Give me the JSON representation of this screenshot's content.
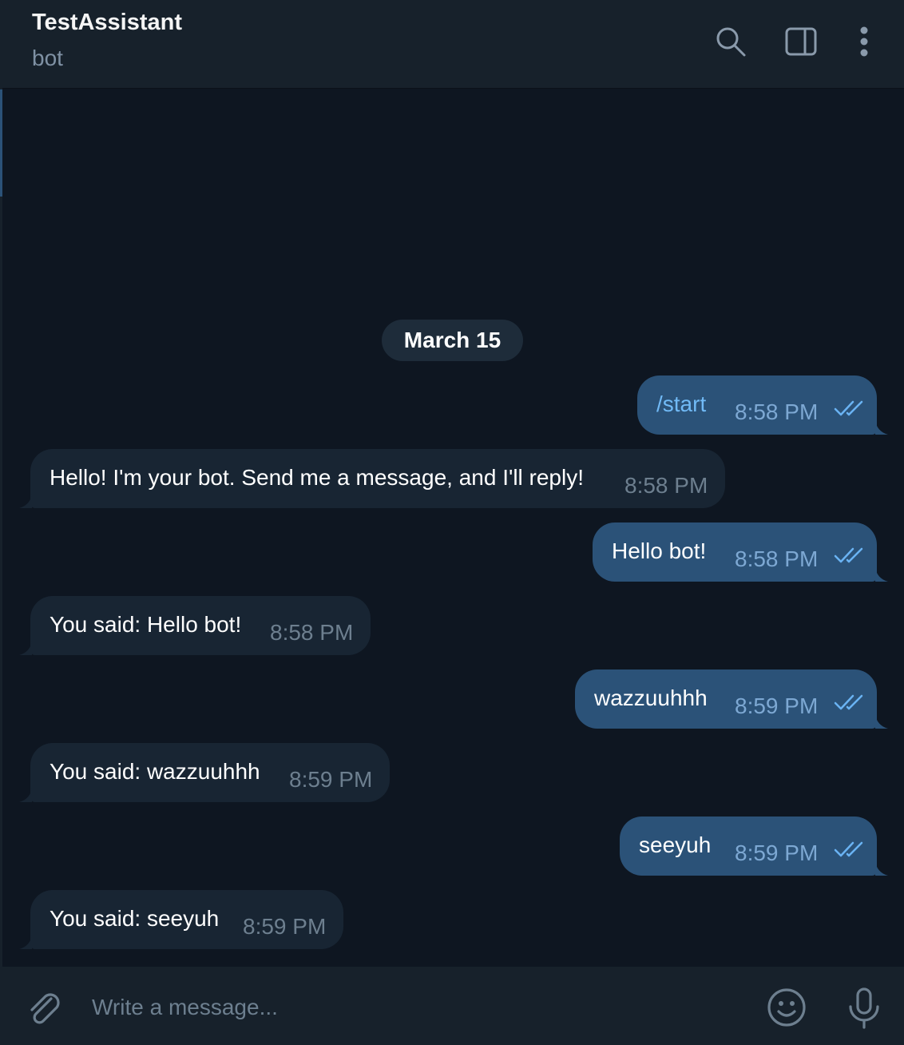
{
  "header": {
    "title": "TestAssistant",
    "subtitle": "bot",
    "icons": [
      "search-icon",
      "sidebar-toggle-icon",
      "more-vertical-icon"
    ]
  },
  "date_separator": "March 15",
  "messages": [
    {
      "direction": "outgoing",
      "text": "/start",
      "time": "8:58 PM",
      "status": "read"
    },
    {
      "direction": "incoming",
      "text": "Hello! I'm your bot. Send me a message, and I'll reply!",
      "time": "8:58 PM"
    },
    {
      "direction": "outgoing",
      "text": "Hello bot!",
      "time": "8:58 PM",
      "status": "read"
    },
    {
      "direction": "incoming",
      "text": "You said: Hello bot!",
      "time": "8:58 PM"
    },
    {
      "direction": "outgoing",
      "text": "wazzuuhhh",
      "time": "8:59 PM",
      "status": "read"
    },
    {
      "direction": "incoming",
      "text": "You said: wazzuuhhh",
      "time": "8:59 PM"
    },
    {
      "direction": "outgoing",
      "text": "seeyuh",
      "time": "8:59 PM",
      "status": "read"
    },
    {
      "direction": "incoming",
      "text": "You said: seeyuh",
      "time": "8:59 PM"
    }
  ],
  "composer": {
    "placeholder": "Write a message...",
    "icons": [
      "paperclip-icon",
      "emoji-icon",
      "microphone-icon"
    ]
  },
  "colors": {
    "background": "#0e1621",
    "header": "#17212b",
    "outgoing_bubble": "#2b5278",
    "incoming_bubble": "#182533",
    "command_text": "#71baf6",
    "read_check": "#6ab3f3"
  }
}
